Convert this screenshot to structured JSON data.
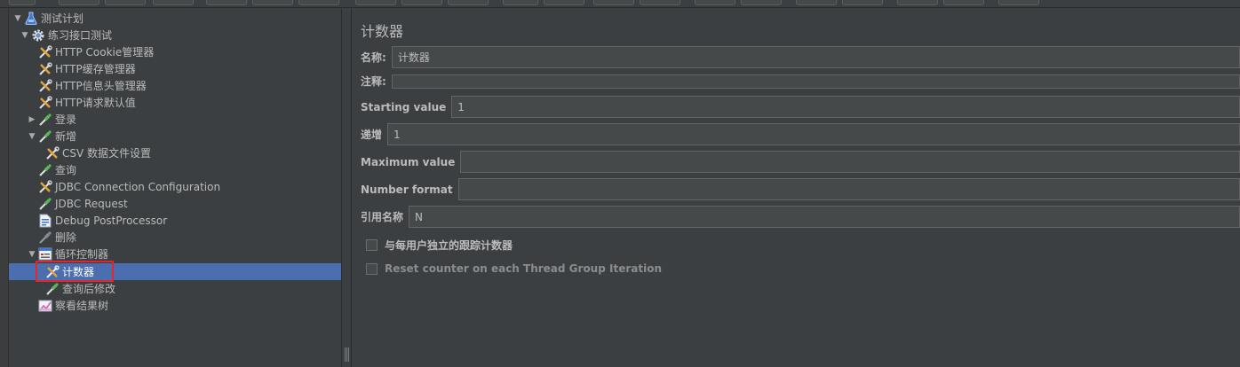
{
  "tree": {
    "nodes": [
      {
        "label": "测试计划",
        "toggle": "▼",
        "icon": "test-plan-icon"
      },
      {
        "label": "练习接口测试",
        "toggle": "▼",
        "icon": "thread-group-gear-icon"
      },
      {
        "label": "HTTP Cookie管理器",
        "toggle": "",
        "icon": "config-element-icon"
      },
      {
        "label": "HTTP缓存管理器",
        "toggle": "",
        "icon": "config-element-icon"
      },
      {
        "label": "HTTP信息头管理器",
        "toggle": "",
        "icon": "config-element-icon"
      },
      {
        "label": "HTTP请求默认值",
        "toggle": "",
        "icon": "config-element-icon"
      },
      {
        "label": "登录",
        "toggle": "▶",
        "icon": "sampler-pipette-icon"
      },
      {
        "label": "新增",
        "toggle": "▼",
        "icon": "sampler-pipette-icon"
      },
      {
        "label": "CSV 数据文件设置",
        "toggle": "",
        "icon": "config-element-icon"
      },
      {
        "label": "查询",
        "toggle": "",
        "icon": "sampler-pipette-icon"
      },
      {
        "label": "JDBC Connection Configuration",
        "toggle": "",
        "icon": "config-element-icon"
      },
      {
        "label": "JDBC Request",
        "toggle": "",
        "icon": "sampler-pipette-icon"
      },
      {
        "label": "Debug PostProcessor",
        "toggle": "",
        "icon": "post-processor-icon"
      },
      {
        "label": "删除",
        "toggle": "",
        "icon": "disabled-sampler-icon"
      },
      {
        "label": "循环控制器",
        "toggle": "▼",
        "icon": "loop-controller-icon"
      },
      {
        "label": "计数器",
        "toggle": "",
        "icon": "config-element-icon"
      },
      {
        "label": "查询后修改",
        "toggle": "",
        "icon": "sampler-pipette-icon"
      },
      {
        "label": "察看结果树",
        "toggle": "",
        "icon": "listener-chart-icon"
      }
    ]
  },
  "form": {
    "title": "计数器",
    "name_label": "名称:",
    "name_value": "计数器",
    "comment_label": "注释:",
    "comment_value": "",
    "start_label": "Starting value",
    "start_value": "1",
    "increment_label": "递增",
    "increment_value": "1",
    "max_label": "Maximum value",
    "max_value": "",
    "format_label": "Number format",
    "format_value": "",
    "ref_label": "引用名称",
    "ref_value": "N",
    "check_independent_label": "与每用户独立的跟踪计数器",
    "check_reset_label": "Reset counter on each Thread Group Iteration"
  },
  "colors": {
    "background": "#3c3f41",
    "selection": "#4b6eaf",
    "highlight_box": "#e0262e",
    "input_bg": "#45494a"
  }
}
